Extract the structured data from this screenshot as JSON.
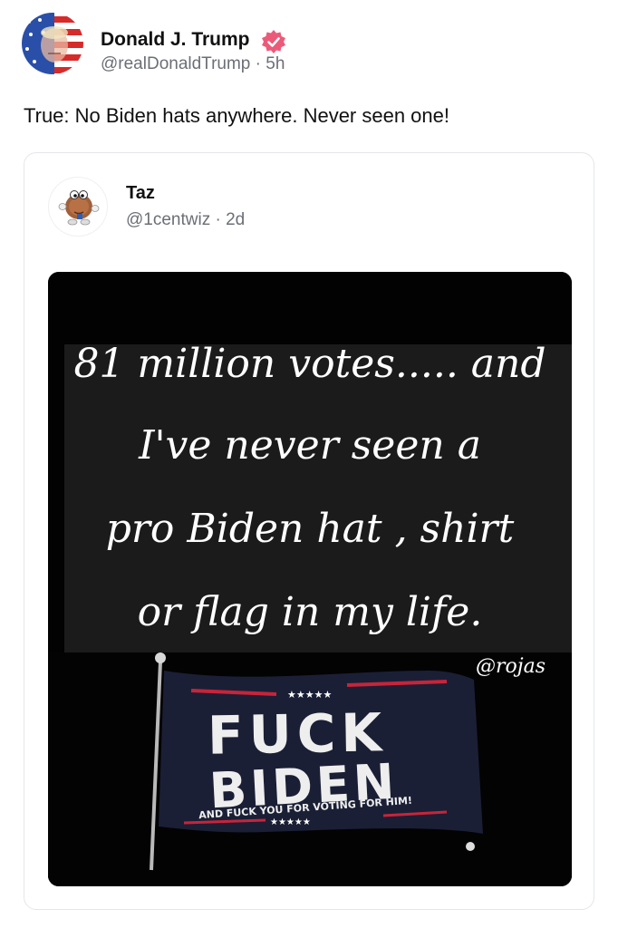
{
  "post": {
    "author_name": "Donald J. Trump",
    "author_meta": "@realDonaldTrump · 5h",
    "text": "True: No Biden hats anywhere. Never seen one!",
    "avatar_icon": "profile-avatar-flag",
    "verified_icon": "verified-badge-icon",
    "verified_color": "#ec5a7a"
  },
  "quote": {
    "author_name": "Taz",
    "author_meta": "@1centwiz · 2d",
    "avatar_icon": "penny-character-avatar",
    "image": {
      "lines": [
        "81 million votes..... and",
        "I've never seen a",
        "pro Biden hat , shirt",
        "or flag in my life."
      ],
      "watermark": "@rojas",
      "flag": {
        "line1": "FUCK",
        "line2": "BIDEN",
        "line3": "AND FUCK YOU FOR VOTING FOR HIM!"
      }
    }
  }
}
